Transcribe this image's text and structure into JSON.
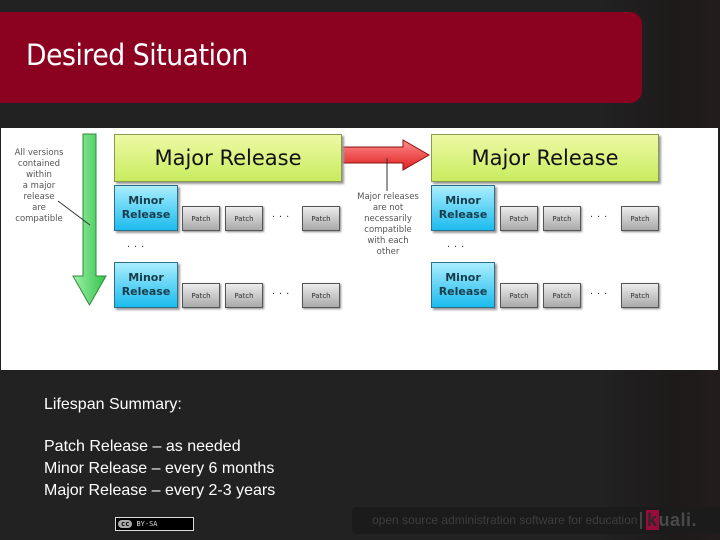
{
  "slide": {
    "title": "Desired Situation",
    "colors": {
      "title_bar": "#8b0220",
      "background": "#222222",
      "major": "#c8ec5e",
      "minor": "#1bbbee",
      "patch": "#a9a9a9"
    }
  },
  "diagram": {
    "left_note": [
      "All versions",
      "contained within",
      "a major release",
      "are compatible"
    ],
    "middle_note": [
      "Major releases",
      "are not",
      "necessarily",
      "compatible",
      "with each",
      "other"
    ],
    "dots": "...",
    "releases": [
      {
        "major_label": "Major Release",
        "minors": [
          {
            "label_line1": "Minor",
            "label_line2": "Release",
            "patches": [
              "Patch",
              "Patch",
              "Patch"
            ]
          },
          {
            "label_line1": "Minor",
            "label_line2": "Release",
            "patches": [
              "Patch",
              "Patch",
              "Patch"
            ]
          }
        ]
      },
      {
        "major_label": "Major Release",
        "minors": [
          {
            "label_line1": "Minor",
            "label_line2": "Release",
            "patches": [
              "Patch",
              "Patch",
              "Patch"
            ]
          },
          {
            "label_line1": "Minor",
            "label_line2": "Release",
            "patches": [
              "Patch",
              "Patch",
              "Patch"
            ]
          }
        ]
      }
    ]
  },
  "summary": {
    "heading": "Lifespan Summary:",
    "lines": [
      "Patch Release – as needed",
      "Minor Release – every 6 months",
      "Major Release – every 2-3 years"
    ]
  },
  "footer": {
    "license_logo": "cc",
    "license_label": "BY-SA",
    "tagline": "open source administration software for education",
    "brand_first": "k",
    "brand_rest": "uali."
  }
}
